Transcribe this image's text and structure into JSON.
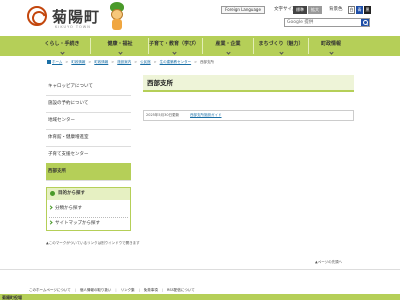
{
  "header": {
    "logo_title": "菊陽町",
    "logo_subtitle": "KIKUYO TOWN",
    "mascot_name": "mascot-character",
    "foreign_language": "Foreign Language",
    "fontsize_label": "文字サイズ",
    "fontsize_standard": "標準",
    "fontsize_large": "拡大",
    "bgcolor_label": "背景色",
    "bg_white": "白",
    "bg_blue": "青",
    "bg_black": "黒",
    "search_placeholder": "Google 提供"
  },
  "gnav": {
    "items": [
      {
        "label": "くらし・手続き"
      },
      {
        "label": "健康・福祉"
      },
      {
        "label": "子育て・教育（学び）"
      },
      {
        "label": "産業・企業"
      },
      {
        "label": "まちづくり（魅力）"
      },
      {
        "label": "町政情報"
      }
    ]
  },
  "breadcrumb": {
    "items": [
      "ホーム",
      "町政情報",
      "町政情報",
      "施設案内",
      "公民館",
      "生の建築教センター",
      "西部支所"
    ]
  },
  "sidebar": {
    "items": [
      {
        "label": "キャロッピアについて"
      },
      {
        "label": "施設の予約について"
      },
      {
        "label": "地域センター"
      },
      {
        "label": "体育館・健康増進室"
      },
      {
        "label": "子育て支援センター"
      },
      {
        "label": "西部支所"
      }
    ],
    "find_title": "目的から探す",
    "find_links": [
      {
        "label": "分類から探す"
      },
      {
        "label": "サイトマップから探す"
      }
    ]
  },
  "main": {
    "title": "西部支所",
    "updated": "2025年5月30日更新",
    "link_text": "西部支所施設ガイド"
  },
  "note": "▲このマークがついているリンクは別ウインドウで開きます",
  "pagetop": "▲ページの先頭へ",
  "footer": {
    "links": [
      "このホームページについて",
      "個人情報の取り扱い",
      "リンク集",
      "免責事項",
      "RSS配信について"
    ],
    "office_name": "菊陽町役場"
  },
  "colors": {
    "accent_green": "#b5cf58",
    "logo_red": "#c3460d",
    "link_blue": "#1a6fa6",
    "button_blue": "#1f4fa8"
  }
}
